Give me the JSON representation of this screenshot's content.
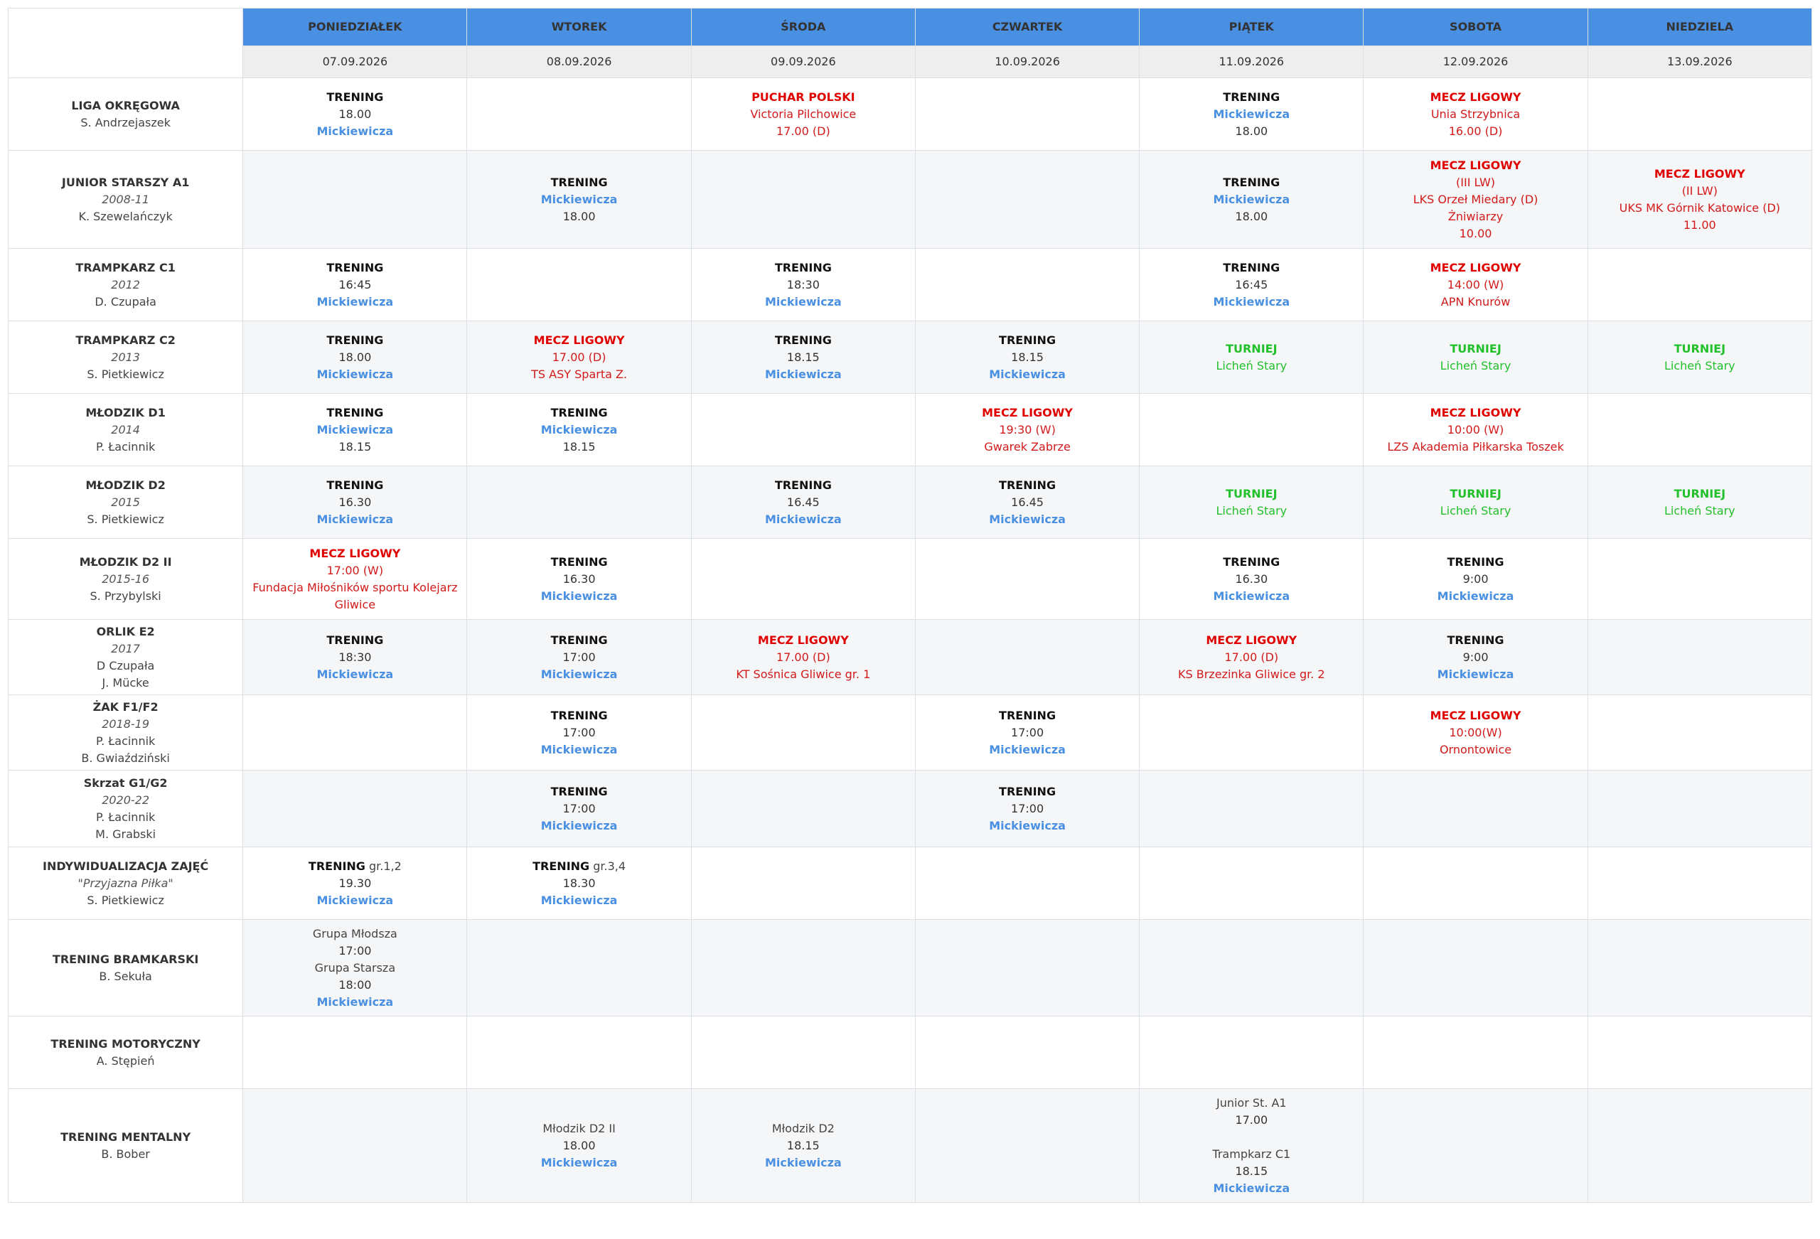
{
  "days": [
    {
      "name": "PONIEDZIAŁEK",
      "date": "07.09.2026"
    },
    {
      "name": "WTOREK",
      "date": "08.09.2026"
    },
    {
      "name": "ŚRODA",
      "date": "09.09.2026"
    },
    {
      "name": "CZWARTEK",
      "date": "10.09.2026"
    },
    {
      "name": "PIĄTEK",
      "date": "11.09.2026"
    },
    {
      "name": "SOBOTA",
      "date": "12.09.2026"
    },
    {
      "name": "NIEDZIELA",
      "date": "13.09.2026"
    }
  ],
  "rows": [
    {
      "team": {
        "name": "LIGA OKRĘGOWA",
        "years": "",
        "coaches": [
          "S. Andrzejaszek"
        ]
      },
      "height": 102,
      "cells": [
        [
          {
            "k": "t",
            "v": "TRENING"
          },
          {
            "k": "time",
            "v": "18.00"
          },
          {
            "k": "loc",
            "v": "Mickiewicza"
          }
        ],
        [],
        [
          {
            "k": "m",
            "v": "PUCHAR POLSKI"
          },
          {
            "k": "mi",
            "v": "Victoria Pilchowice"
          },
          {
            "k": "mi",
            "v": "17.00 (D)"
          }
        ],
        [],
        [
          {
            "k": "t",
            "v": "TRENING"
          },
          {
            "k": "loc",
            "v": "Mickiewicza"
          },
          {
            "k": "time",
            "v": "18.00"
          }
        ],
        [
          {
            "k": "m",
            "v": "MECZ LIGOWY"
          },
          {
            "k": "mi",
            "v": "Unia Strzybnica"
          },
          {
            "k": "mi",
            "v": "16.00 (D)"
          }
        ],
        []
      ]
    },
    {
      "team": {
        "name": "JUNIOR STARSZY A1",
        "years": "2008-11",
        "coaches": [
          "K. Szewelańczyk"
        ]
      },
      "height": 138,
      "cells": [
        [],
        [
          {
            "k": "t",
            "v": "TRENING"
          },
          {
            "k": "loc",
            "v": "Mickiewicza"
          },
          {
            "k": "time",
            "v": "18.00"
          }
        ],
        [],
        [],
        [
          {
            "k": "t",
            "v": "TRENING"
          },
          {
            "k": "loc",
            "v": "Mickiewicza"
          },
          {
            "k": "time",
            "v": "18.00"
          }
        ],
        [
          {
            "k": "m",
            "v": "MECZ LIGOWY"
          },
          {
            "k": "mi",
            "v": "(III LW)"
          },
          {
            "k": "mi",
            "v": "LKS Orzeł Miedary (D)"
          },
          {
            "k": "mi",
            "v": "Żniwiarzy"
          },
          {
            "k": "mi",
            "v": "10.00"
          }
        ],
        [
          {
            "k": "m",
            "v": "MECZ LIGOWY"
          },
          {
            "k": "mi",
            "v": "(II LW)"
          },
          {
            "k": "mi",
            "v": "UKS MK Górnik Katowice (D)"
          },
          {
            "k": "mi",
            "v": "11.00"
          }
        ]
      ]
    },
    {
      "team": {
        "name": "TRAMPKARZ C1",
        "years": "2012",
        "coaches": [
          "D. Czupała"
        ]
      },
      "height": 102,
      "cells": [
        [
          {
            "k": "t",
            "v": "TRENING"
          },
          {
            "k": "time",
            "v": "16:45"
          },
          {
            "k": "loc",
            "v": "Mickiewicza"
          }
        ],
        [],
        [
          {
            "k": "t",
            "v": "TRENING"
          },
          {
            "k": "time",
            "v": "18:30"
          },
          {
            "k": "loc",
            "v": "Mickiewicza"
          }
        ],
        [],
        [
          {
            "k": "t",
            "v": "TRENING"
          },
          {
            "k": "time",
            "v": "16:45"
          },
          {
            "k": "loc",
            "v": "Mickiewicza"
          }
        ],
        [
          {
            "k": "m",
            "v": "MECZ LIGOWY"
          },
          {
            "k": "mi",
            "v": "14:00 (W)"
          },
          {
            "k": "mi",
            "v": "APN Knurów"
          }
        ],
        []
      ]
    },
    {
      "team": {
        "name": "TRAMPKARZ C2",
        "years": "2013",
        "coaches": [
          "S. Pietkiewicz"
        ]
      },
      "height": 102,
      "cells": [
        [
          {
            "k": "t",
            "v": "TRENING"
          },
          {
            "k": "time",
            "v": "18.00"
          },
          {
            "k": "loc",
            "v": "Mickiewicza"
          }
        ],
        [
          {
            "k": "m",
            "v": "MECZ LIGOWY"
          },
          {
            "k": "mi",
            "v": "17.00 (D)"
          },
          {
            "k": "mi",
            "v": "TS ASY Sparta Z."
          }
        ],
        [
          {
            "k": "t",
            "v": "TRENING"
          },
          {
            "k": "time",
            "v": "18.15"
          },
          {
            "k": "loc",
            "v": "Mickiewicza"
          }
        ],
        [
          {
            "k": "t",
            "v": "TRENING"
          },
          {
            "k": "time",
            "v": "18.15"
          },
          {
            "k": "loc",
            "v": "Mickiewicza"
          }
        ],
        [
          {
            "k": "tu",
            "v": "TURNIEJ"
          },
          {
            "k": "ti",
            "v": "Licheń Stary"
          }
        ],
        [
          {
            "k": "tu",
            "v": "TURNIEJ"
          },
          {
            "k": "ti",
            "v": "Licheń Stary"
          }
        ],
        [
          {
            "k": "tu",
            "v": "TURNIEJ"
          },
          {
            "k": "ti",
            "v": "Licheń Stary"
          }
        ]
      ]
    },
    {
      "team": {
        "name": "MŁODZIK D1",
        "years": "2014",
        "coaches": [
          "P. Łacinnik"
        ]
      },
      "height": 102,
      "cells": [
        [
          {
            "k": "t",
            "v": "TRENING"
          },
          {
            "k": "loc",
            "v": "Mickiewicza"
          },
          {
            "k": "time",
            "v": "18.15"
          }
        ],
        [
          {
            "k": "t",
            "v": "TRENING"
          },
          {
            "k": "loc",
            "v": "Mickiewicza"
          },
          {
            "k": "time",
            "v": "18.15"
          }
        ],
        [],
        [
          {
            "k": "m",
            "v": "MECZ LIGOWY"
          },
          {
            "k": "mi",
            "v": "19:30 (W)"
          },
          {
            "k": "mi",
            "v": "Gwarek Zabrze"
          }
        ],
        [],
        [
          {
            "k": "m",
            "v": "MECZ LIGOWY"
          },
          {
            "k": "mi",
            "v": "10:00 (W)"
          },
          {
            "k": "mi",
            "v": "LZS Akademia Piłkarska Toszek"
          }
        ],
        []
      ]
    },
    {
      "team": {
        "name": "MŁODZIK D2",
        "years": "2015",
        "coaches": [
          "S. Pietkiewicz"
        ]
      },
      "height": 102,
      "cells": [
        [
          {
            "k": "t",
            "v": "TRENING"
          },
          {
            "k": "time",
            "v": "16.30"
          },
          {
            "k": "loc",
            "v": "Mickiewicza"
          }
        ],
        [],
        [
          {
            "k": "t",
            "v": "TRENING"
          },
          {
            "k": "time",
            "v": "16.45"
          },
          {
            "k": "loc",
            "v": "Mickiewicza"
          }
        ],
        [
          {
            "k": "t",
            "v": "TRENING"
          },
          {
            "k": "time",
            "v": "16.45"
          },
          {
            "k": "loc",
            "v": "Mickiewicza"
          }
        ],
        [
          {
            "k": "tu",
            "v": "TURNIEJ"
          },
          {
            "k": "ti",
            "v": "Licheń Stary"
          }
        ],
        [
          {
            "k": "tu",
            "v": "TURNIEJ"
          },
          {
            "k": "ti",
            "v": "Licheń Stary"
          }
        ],
        [
          {
            "k": "tu",
            "v": "TURNIEJ"
          },
          {
            "k": "ti",
            "v": "Licheń Stary"
          }
        ]
      ]
    },
    {
      "team": {
        "name": "MŁODZIK D2 II",
        "years": "2015-16",
        "coaches": [
          "S. Przybylski"
        ]
      },
      "height": 114,
      "cells": [
        [
          {
            "k": "m",
            "v": "MECZ LIGOWY"
          },
          {
            "k": "mi",
            "v": "17:00 (W)"
          },
          {
            "k": "mi",
            "v": "Fundacja Miłośników sportu Kolejarz Gliwice"
          }
        ],
        [
          {
            "k": "t",
            "v": "TRENING"
          },
          {
            "k": "time",
            "v": "16.30"
          },
          {
            "k": "loc",
            "v": "Mickiewicza"
          }
        ],
        [],
        [],
        [
          {
            "k": "t",
            "v": "TRENING"
          },
          {
            "k": "time",
            "v": "16.30"
          },
          {
            "k": "loc",
            "v": "Mickiewicza"
          }
        ],
        [
          {
            "k": "t",
            "v": "TRENING"
          },
          {
            "k": "time",
            "v": "9:00"
          },
          {
            "k": "loc",
            "v": "Mickiewicza"
          }
        ],
        []
      ]
    },
    {
      "team": {
        "name": "ORLIK E2",
        "years": "2017",
        "coaches": [
          "D Czupała",
          "J. Mücke"
        ]
      },
      "height": 106,
      "cells": [
        [
          {
            "k": "t",
            "v": "TRENING"
          },
          {
            "k": "time",
            "v": "18:30"
          },
          {
            "k": "loc",
            "v": "Mickiewicza"
          }
        ],
        [
          {
            "k": "t",
            "v": "TRENING"
          },
          {
            "k": "time",
            "v": "17:00"
          },
          {
            "k": "loc",
            "v": "Mickiewicza"
          }
        ],
        [
          {
            "k": "m",
            "v": "MECZ LIGOWY"
          },
          {
            "k": "mi",
            "v": "17.00 (D)"
          },
          {
            "k": "mi",
            "v": "KT Sośnica Gliwice gr. 1"
          }
        ],
        [],
        [
          {
            "k": "m",
            "v": "MECZ LIGOWY"
          },
          {
            "k": "mi",
            "v": "17.00 (D)"
          },
          {
            "k": "mi",
            "v": "KS Brzezinka Gliwice gr. 2"
          }
        ],
        [
          {
            "k": "t",
            "v": "TRENING"
          },
          {
            "k": "time",
            "v": "9:00"
          },
          {
            "k": "loc",
            "v": "Mickiewicza"
          }
        ],
        []
      ]
    },
    {
      "team": {
        "name": "ŻAK F1/F2",
        "years": "2018-19",
        "coaches": [
          "P. Łacinnik",
          "B. Gwiaździński"
        ]
      },
      "height": 106,
      "cells": [
        [],
        [
          {
            "k": "t",
            "v": "TRENING"
          },
          {
            "k": "time",
            "v": "17:00"
          },
          {
            "k": "loc",
            "v": "Mickiewicza"
          }
        ],
        [],
        [
          {
            "k": "t",
            "v": "TRENING"
          },
          {
            "k": "time",
            "v": "17:00"
          },
          {
            "k": "loc",
            "v": "Mickiewicza"
          }
        ],
        [],
        [
          {
            "k": "m",
            "v": "MECZ LIGOWY"
          },
          {
            "k": "mi",
            "v": "10:00(W)"
          },
          {
            "k": "mi",
            "v": "Ornontowice"
          }
        ],
        []
      ]
    },
    {
      "team": {
        "name": "Skrzat G1/G2",
        "years": "2020-22",
        "coaches": [
          "P. Łacinnik",
          "M. Grabski"
        ]
      },
      "height": 108,
      "cells": [
        [],
        [
          {
            "k": "t",
            "v": "TRENING"
          },
          {
            "k": "time",
            "v": "17:00"
          },
          {
            "k": "loc",
            "v": "Mickiewicza"
          }
        ],
        [],
        [
          {
            "k": "t",
            "v": "TRENING"
          },
          {
            "k": "time",
            "v": "17:00"
          },
          {
            "k": "loc",
            "v": "Mickiewicza"
          }
        ],
        [],
        [],
        []
      ]
    },
    {
      "team": {
        "name": "INDYWIDUALIZACJA ZAJĘĆ",
        "years": "\"Przyjazna Piłka\"",
        "coaches": [
          "S. Pietkiewicz"
        ]
      },
      "height": 102,
      "cells": [
        [
          {
            "k": "t",
            "v": "TRENING",
            "extra": " gr.1,2"
          },
          {
            "k": "time",
            "v": "19.30"
          },
          {
            "k": "loc",
            "v": "Mickiewicza"
          }
        ],
        [
          {
            "k": "t",
            "v": "TRENING",
            "extra": " gr.3,4"
          },
          {
            "k": "time",
            "v": "18.30"
          },
          {
            "k": "loc",
            "v": "Mickiewicza"
          }
        ],
        [],
        [],
        [],
        [],
        []
      ]
    },
    {
      "team": {
        "name": "TRENING BRAMKARSKI",
        "years": "",
        "coaches": [
          "B. Sekuła"
        ]
      },
      "height": 136,
      "cells": [
        [
          {
            "k": "p",
            "v": "Grupa Młodsza"
          },
          {
            "k": "time",
            "v": "17:00"
          },
          {
            "k": "p",
            "v": "Grupa Starsza"
          },
          {
            "k": "time",
            "v": "18:00"
          },
          {
            "k": "loc",
            "v": "Mickiewicza"
          }
        ],
        [],
        [],
        [],
        [],
        [],
        []
      ]
    },
    {
      "team": {
        "name": "TRENING MOTORYCZNY",
        "years": "",
        "coaches": [
          "A. Stępień"
        ]
      },
      "height": 102,
      "cells": [
        [],
        [],
        [],
        [],
        [],
        [],
        []
      ]
    },
    {
      "team": {
        "name": "TRENING MENTALNY",
        "years": "",
        "coaches": [
          "B. Bober"
        ]
      },
      "height": 160,
      "cells": [
        [],
        [
          {
            "k": "p",
            "v": "Młodzik D2 II"
          },
          {
            "k": "time",
            "v": "18.00"
          },
          {
            "k": "loc",
            "v": "Mickiewicza"
          }
        ],
        [
          {
            "k": "p",
            "v": "Młodzik D2"
          },
          {
            "k": "time",
            "v": "18.15"
          },
          {
            "k": "loc",
            "v": "Mickiewicza"
          }
        ],
        [],
        [
          {
            "k": "p",
            "v": "Junior St. A1"
          },
          {
            "k": "time",
            "v": "17.00"
          },
          {
            "k": "blank",
            "v": ""
          },
          {
            "k": "p",
            "v": "Trampkarz C1"
          },
          {
            "k": "time",
            "v": "18.15"
          },
          {
            "k": "loc",
            "v": "Mickiewicza"
          }
        ],
        [],
        []
      ]
    }
  ],
  "colors": {
    "header_bg": "#4a90e2",
    "training_location": "#4a90e2",
    "match": "#e00000",
    "tournament": "#22c02b"
  }
}
